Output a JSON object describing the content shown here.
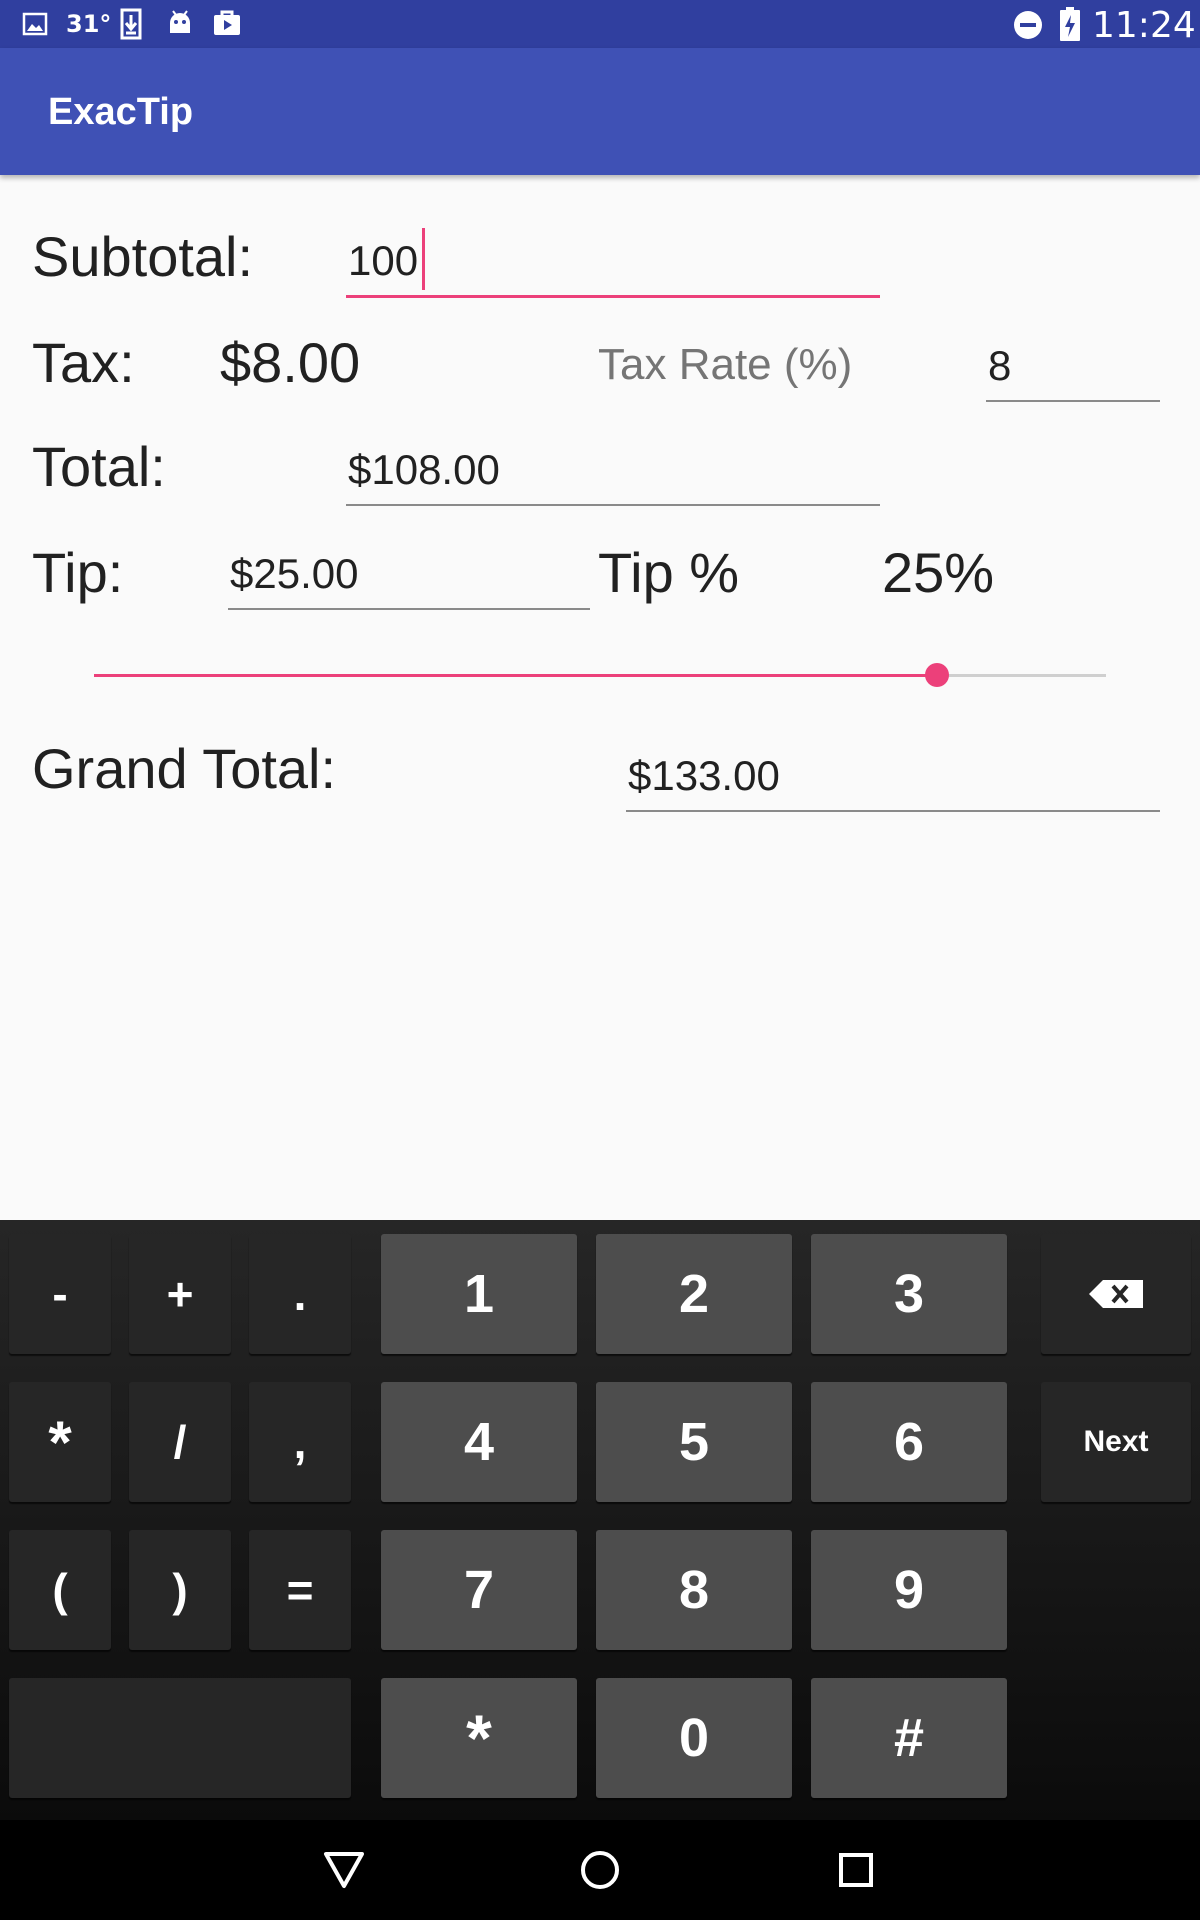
{
  "status_bar": {
    "temperature": "31°",
    "time": "11:24"
  },
  "app_bar": {
    "title": "ExacTip"
  },
  "form": {
    "subtotal_label": "Subtotal:",
    "subtotal_value": "100",
    "tax_label": "Tax:",
    "tax_value": "$8.00",
    "tax_rate_label": "Tax Rate (%)",
    "tax_rate_value": "8",
    "total_label": "Total:",
    "total_value": "$108.00",
    "tip_label": "Tip:",
    "tip_value": "$25.00",
    "tip_percent_label": "Tip %",
    "tip_percent_value": "25%",
    "tip_slider_fraction": 0.833,
    "grand_total_label": "Grand Total:",
    "grand_total_value": "$133.00"
  },
  "colors": {
    "primary": "#3f51b5",
    "primary_dark": "#303f9f",
    "accent": "#ec407a"
  },
  "keyboard": {
    "row1": [
      "-",
      "+",
      ".",
      "1",
      "2",
      "3"
    ],
    "row2": [
      "*",
      "/",
      ",",
      "4",
      "5",
      "6"
    ],
    "next_label": "Next",
    "row3": [
      "(",
      ")",
      "=",
      "7",
      "8",
      "9"
    ],
    "row4": [
      "*",
      "0",
      "#"
    ],
    "backspace_icon": "backspace-icon"
  },
  "nav_bar": {
    "icons": [
      "back-icon",
      "home-icon",
      "recents-icon"
    ]
  }
}
